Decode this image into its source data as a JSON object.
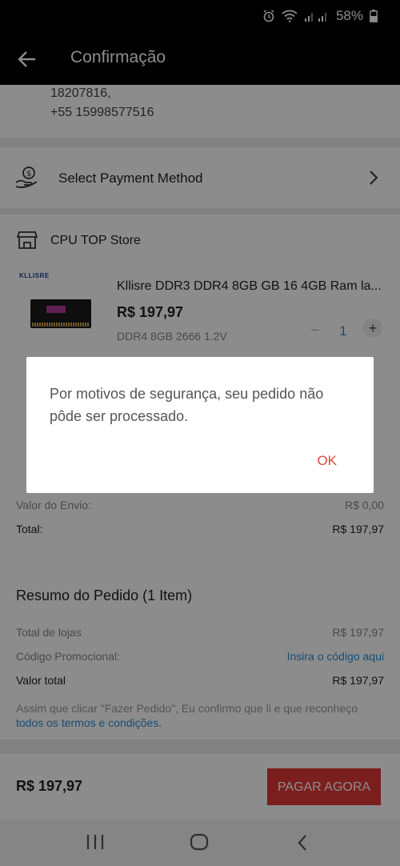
{
  "status": {
    "battery": "58%"
  },
  "appbar": {
    "title": "Confirmação"
  },
  "address": {
    "line1": "18207816,",
    "line2": "+55 15998577516"
  },
  "payment": {
    "label": "Select Payment Method"
  },
  "store": {
    "name": "CPU TOP Store",
    "product": {
      "brand_logo": "KLLISRE",
      "name": "Kllisre DDR3 DDR4 8GB GB 16 4GB Ram la...",
      "price": "R$ 197,97",
      "variant": "DDR4 8GB 2666 1.2V",
      "quantity": "1"
    },
    "rows": {
      "shipping_label": "Valor do Envio:",
      "shipping_value": "R$ 0,00",
      "total_label": "Total:",
      "total_value": "R$ 197,97"
    }
  },
  "summary": {
    "title": "Resumo do Pedido (1 Item)",
    "stores_total_label": "Total de lojas",
    "stores_total_value": "R$ 197,97",
    "promo_label": "Código Promocional:",
    "promo_link": "Insira o código aqui",
    "grand_total_label": "Valor total",
    "grand_total_value": "R$ 197,97",
    "terms_text": "Assim que clicar \"Fazer Pedido\", Eu confirmo que li e que reconheço",
    "terms_link": "todos os termos e condições."
  },
  "footer": {
    "price": "R$ 197,97",
    "pay_button": "PAGAR AGORA"
  },
  "dialog": {
    "message": "Por motivos de segurança, seu pedido não pôde ser processado.",
    "ok": "OK"
  },
  "colors": {
    "accent": "#e03a37",
    "link": "#2a8fd6"
  }
}
